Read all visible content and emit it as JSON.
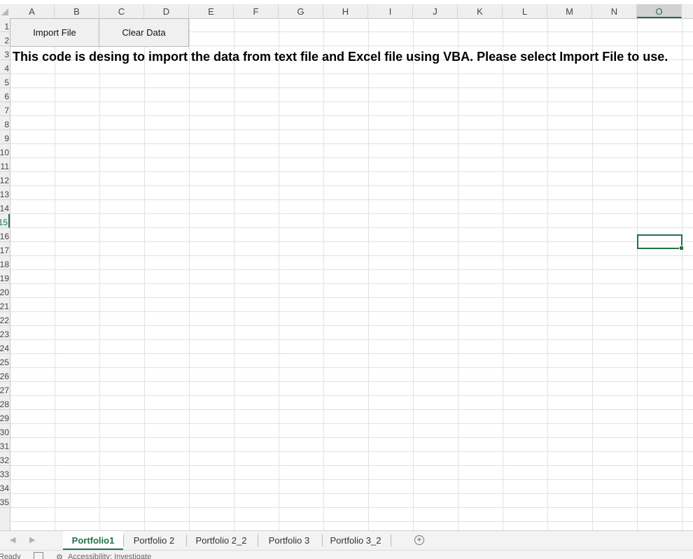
{
  "columns": [
    "A",
    "B",
    "C",
    "D",
    "E",
    "F",
    "G",
    "H",
    "I",
    "J",
    "K",
    "L",
    "M",
    "N",
    "O"
  ],
  "selected_column": "O",
  "rows": [
    "1",
    "2",
    "3",
    "4",
    "5",
    "6",
    "7",
    "8",
    "9",
    "10",
    "11",
    "12",
    "13",
    "14",
    "15",
    "16",
    "17",
    "18",
    "19",
    "20",
    "21",
    "22",
    "23",
    "24",
    "25",
    "26",
    "27",
    "28",
    "29",
    "30",
    "31",
    "32",
    "33",
    "34",
    "35"
  ],
  "selected_row": "15",
  "buttons": {
    "import_label": "Import File",
    "clear_label": "Clear Data"
  },
  "row2_text": "This code is desing to import the data from text file and Excel file using VBA. Please select Import File to use.",
  "sheet_tabs": [
    "Portfolio1",
    "Portfolio 2",
    "Portfolio 2_2",
    "Portfolio 3",
    "Portfolio 3_2"
  ],
  "active_tab": "Portfolio1",
  "status": {
    "ready": "Ready",
    "accessibility": "Accessibility: Investigate"
  },
  "accent_color": "#217346"
}
